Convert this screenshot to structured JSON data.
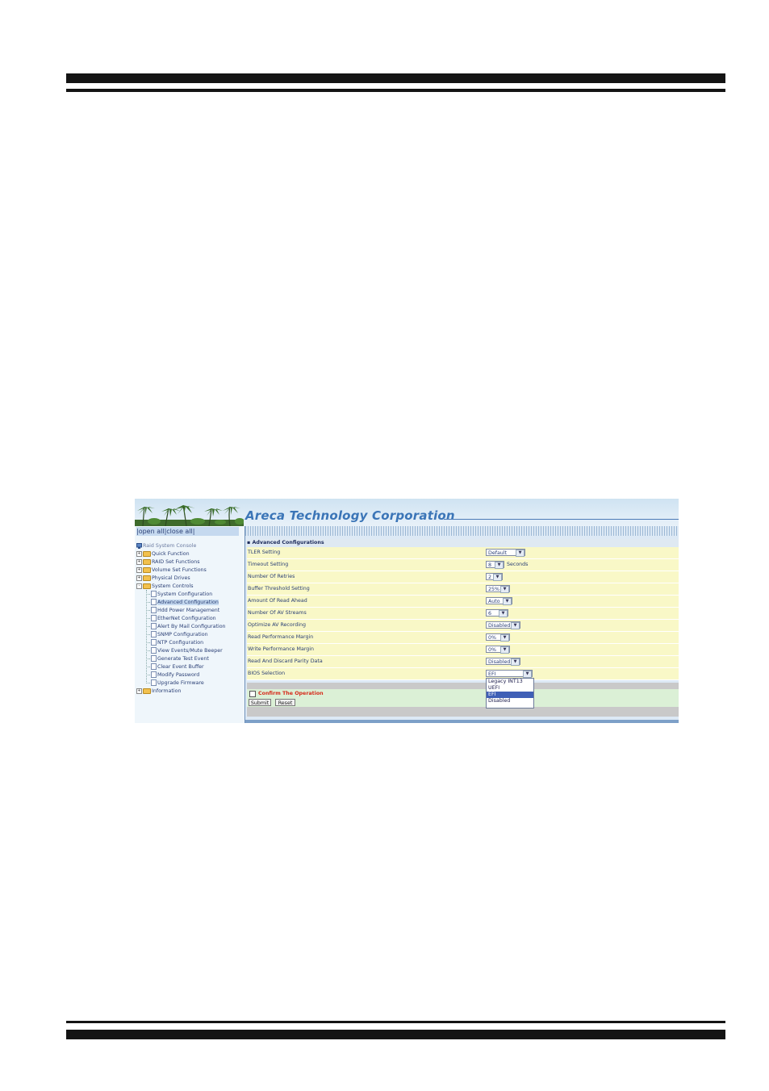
{
  "app": {
    "brand": "Areca Technology Corporation"
  },
  "sidebar": {
    "open_all": "open all",
    "close_all": "close all",
    "root": "Raid System Console",
    "groups": [
      {
        "label": "Quick Function",
        "expander": "+"
      },
      {
        "label": "RAID Set Functions",
        "expander": "+"
      },
      {
        "label": "Volume Set Functions",
        "expander": "+"
      },
      {
        "label": "Physical Drives",
        "expander": "+"
      },
      {
        "label": "System Controls",
        "expander": "-"
      }
    ],
    "system_controls_items": [
      "System Configuration",
      "Advanced Configuration",
      "Hdd Power Management",
      "EtherNet Configuration",
      "Alert By Mail Configuration",
      "SNMP Configuration",
      "NTP Configuration",
      "View Events/Mute Beeper",
      "Generate Test Event",
      "Clear Event Buffer",
      "Modify Password",
      "Upgrade Firmware"
    ],
    "selected_item": "Advanced Configuration",
    "information": {
      "label": "Information",
      "expander": "+"
    }
  },
  "main": {
    "header_bullet": "▪",
    "header": "Advanced Configurations",
    "rows": [
      {
        "label": "TLER Setting",
        "value": "Default",
        "unit": ""
      },
      {
        "label": "Timeout Setting",
        "value": "8",
        "unit": "Seconds"
      },
      {
        "label": "Number Of Retries",
        "value": "2",
        "unit": ""
      },
      {
        "label": "Buffer Threshold Setting",
        "value": "25%",
        "unit": ""
      },
      {
        "label": "Amount Of Read Ahead",
        "value": "Auto",
        "unit": ""
      },
      {
        "label": "Number Of AV Streams",
        "value": "6",
        "unit": ""
      },
      {
        "label": "Optimize AV Recording",
        "value": "Disabled",
        "unit": ""
      },
      {
        "label": "Read Performance Margin",
        "value": "0%",
        "unit": ""
      },
      {
        "label": "Write Performance Margin",
        "value": "0%",
        "unit": ""
      },
      {
        "label": "Read And Discard Parity Data",
        "value": "Disabled",
        "unit": ""
      },
      {
        "label": "BIOS Selection",
        "value": "EFI",
        "unit": ""
      }
    ],
    "bios_options": [
      "Legacy INT13",
      "UEFI",
      "EFI",
      "Disabled"
    ],
    "bios_highlighted": "EFI",
    "confirm_label": "Confirm The Operation",
    "confirm_checked": false,
    "submit_label": "Submit",
    "reset_label": "Reset"
  },
  "icons": {
    "expander": "plus-minus-box",
    "folder": "folder-icon",
    "page": "page-icon",
    "monitor": "monitor-icon",
    "dropdown_arrow": "chevron-down-icon"
  },
  "colors": {
    "brand": "#3b75b7",
    "row_background": "#f9f8c7",
    "confirm_background": "#dbf0d6",
    "confirm_text": "#d62b1b",
    "highlight": "#3f5fb6"
  }
}
